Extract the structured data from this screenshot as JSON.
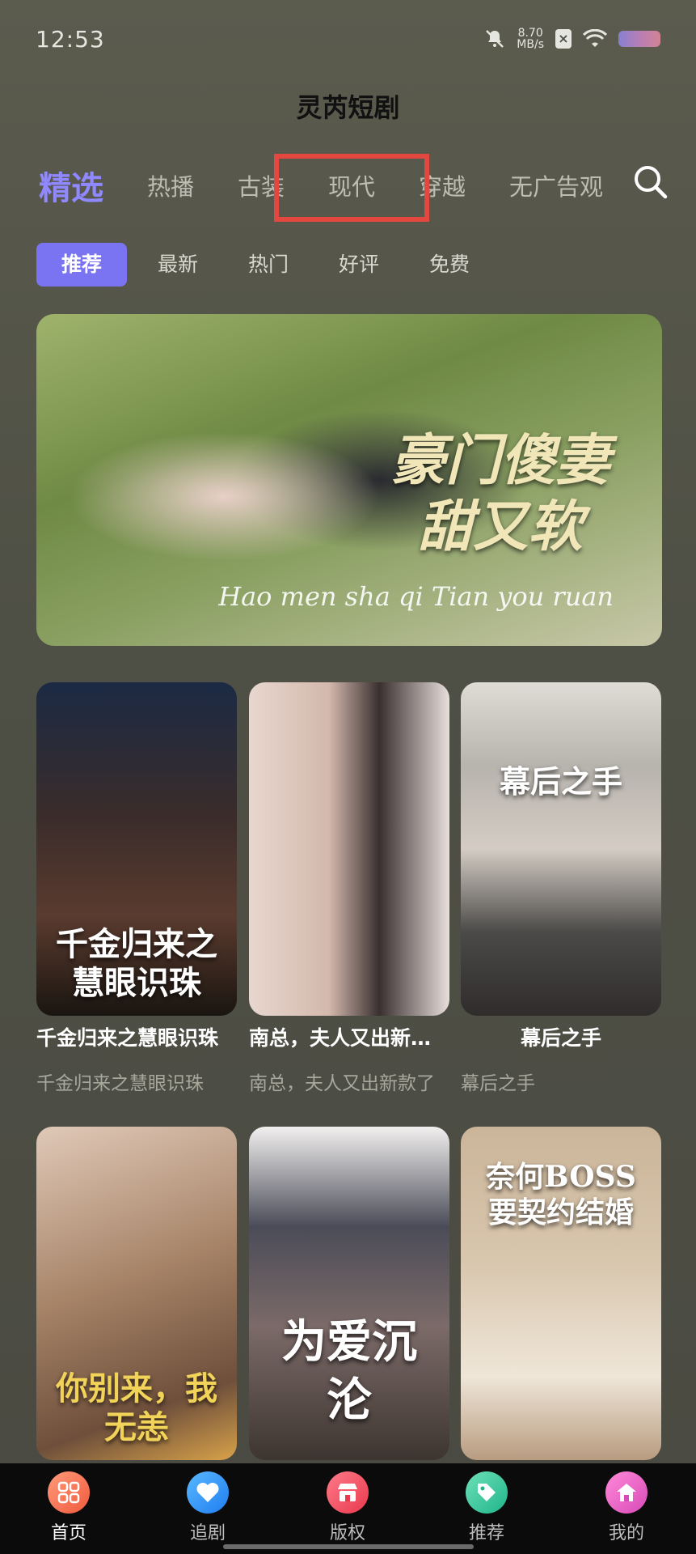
{
  "status_bar": {
    "time": "12:53",
    "net_speed_value": "8.70",
    "net_speed_unit": "MB/s"
  },
  "app_title": "灵芮短剧",
  "category_tabs": [
    {
      "label": "精选",
      "active": true
    },
    {
      "label": "热播"
    },
    {
      "label": "古装"
    },
    {
      "label": "现代"
    },
    {
      "label": "穿越"
    },
    {
      "label": "无广告观"
    }
  ],
  "sub_tabs": [
    {
      "label": "推荐",
      "active": true
    },
    {
      "label": "最新"
    },
    {
      "label": "热门"
    },
    {
      "label": "好评"
    },
    {
      "label": "免费"
    }
  ],
  "banner": {
    "title_line1": "豪门傻妻",
    "title_line2": "甜又软",
    "pinyin": "Hao men sha qi  Tian you ruan"
  },
  "cards": [
    {
      "poster_text": "千金归来之慧眼识珠",
      "title": "千金归来之慧眼识珠",
      "subtitle": "千金归来之慧眼识珠"
    },
    {
      "poster_text": "",
      "title": "南总，夫人又出新…",
      "subtitle": "南总，夫人又出新款了"
    },
    {
      "poster_text": "幕后之手",
      "title": "幕后之手",
      "subtitle": "幕后之手"
    },
    {
      "poster_text": "你别来，我无恙",
      "title": "",
      "subtitle": ""
    },
    {
      "poster_text": "为爱沉沦",
      "title": "",
      "subtitle": ""
    },
    {
      "poster_text": "奈何BOSS要契约结婚",
      "title": "",
      "subtitle": ""
    }
  ],
  "bottom_nav": [
    {
      "label": "首页",
      "icon": "home-grid-icon",
      "active": true
    },
    {
      "label": "追剧",
      "icon": "heart-icon"
    },
    {
      "label": "版权",
      "icon": "store-icon"
    },
    {
      "label": "推荐",
      "icon": "tag-icon"
    },
    {
      "label": "我的",
      "icon": "house-icon"
    }
  ],
  "colors": {
    "accent": "#7b74f2",
    "highlight": "#e4473f"
  }
}
